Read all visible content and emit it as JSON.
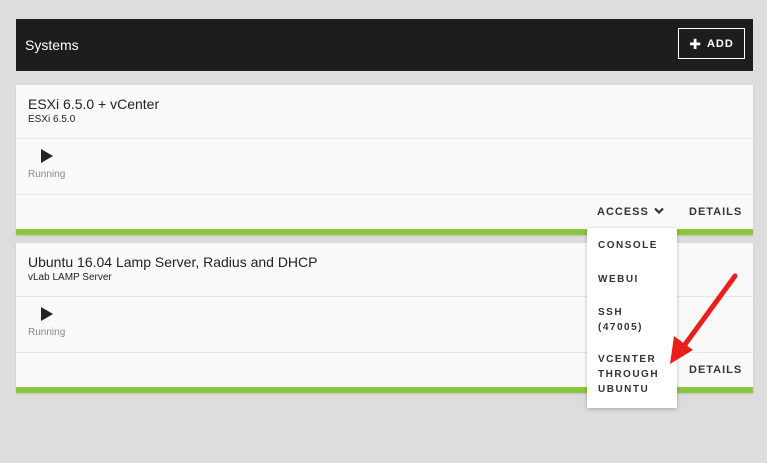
{
  "header": {
    "title": "Systems",
    "add_label": "ADD"
  },
  "systems": [
    {
      "name": "ESXi 6.5.0 + vCenter",
      "subname": "ESXi 6.5.0",
      "status": "Running",
      "access_label": "ACCESS",
      "details_label": "DETAILS"
    },
    {
      "name": "Ubuntu 16.04 Lamp Server, Radius and DHCP",
      "subname": "vLab LAMP Server",
      "status": "Running",
      "details_label": "DETAILS"
    }
  ],
  "access_menu": {
    "items": [
      "CONSOLE",
      "WEBUI",
      "SSH (47005)",
      "VCENTER THROUGH UBUNTU"
    ]
  },
  "colors": {
    "accent": "#8cc63f",
    "header_bg": "#1c1d1e",
    "arrow": "#e8201c"
  },
  "icons": [
    "plus-icon",
    "play-icon",
    "chevron-down-icon",
    "red-arrow-annotation"
  ]
}
